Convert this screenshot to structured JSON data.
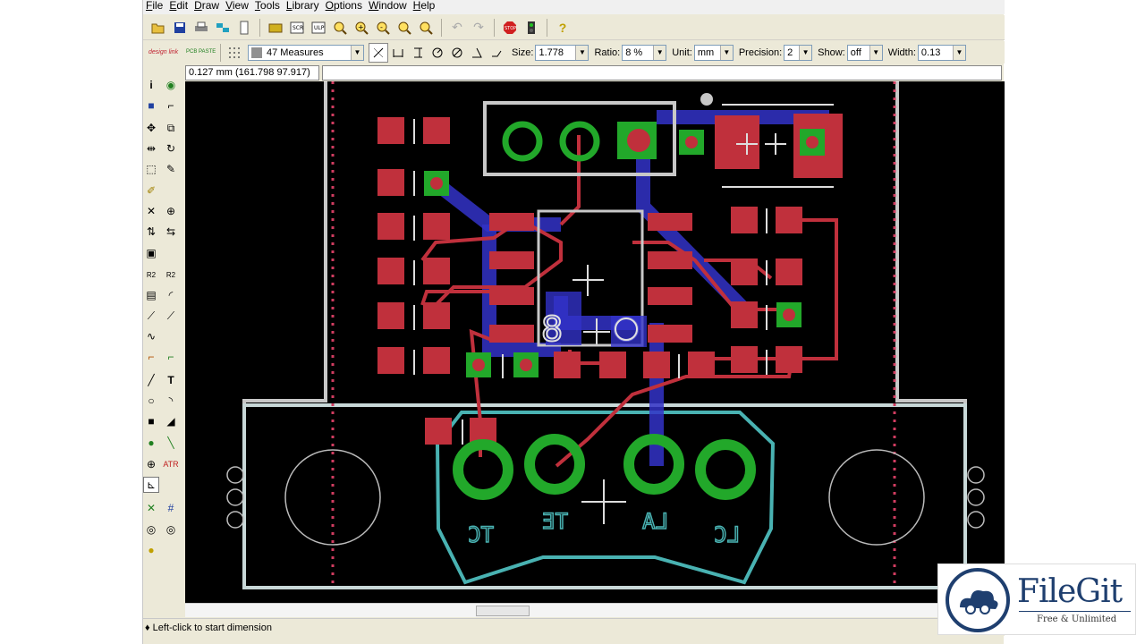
{
  "menu": [
    "File",
    "Edit",
    "Draw",
    "View",
    "Tools",
    "Library",
    "Options",
    "Window",
    "Help"
  ],
  "toolbar2": {
    "logo1": "design link",
    "logo2": "PCB PASTE",
    "layer_combo": "47 Measures",
    "size_label": "Size:",
    "size_value": "1.778",
    "ratio_label": "Ratio:",
    "ratio_value": "8 %",
    "unit_label": "Unit:",
    "unit_value": "mm",
    "precision_label": "Precision:",
    "precision_value": "2",
    "show_label": "Show:",
    "show_value": "off",
    "width_label": "Width:",
    "width_value": "0.13"
  },
  "coord_readout": "0.127 mm (161.798 97.917)",
  "status": "♦ Left-click to start dimension",
  "board": {
    "pad_labels": [
      "TC",
      "TE",
      "LA",
      "LC"
    ],
    "ic_marker": "8",
    "colors": {
      "top_copper": "#c0303c",
      "bottom_copper": "#3232c8",
      "pad": "#22a82a",
      "outline": "#c8c8c8",
      "connector": "#49b2b2",
      "dimension": "#d03c60"
    }
  },
  "watermark": {
    "name": "FileGit",
    "tagline": "Free & Unlimited"
  },
  "icons": [
    "open-icon",
    "save-icon",
    "print-icon",
    "cam-icon",
    "script-icon",
    "library-icon",
    "zoom-in-icon",
    "zoom-out-icon",
    "undo-icon",
    "redo-icon",
    "stop-icon",
    "run-icon",
    "help-icon"
  ]
}
